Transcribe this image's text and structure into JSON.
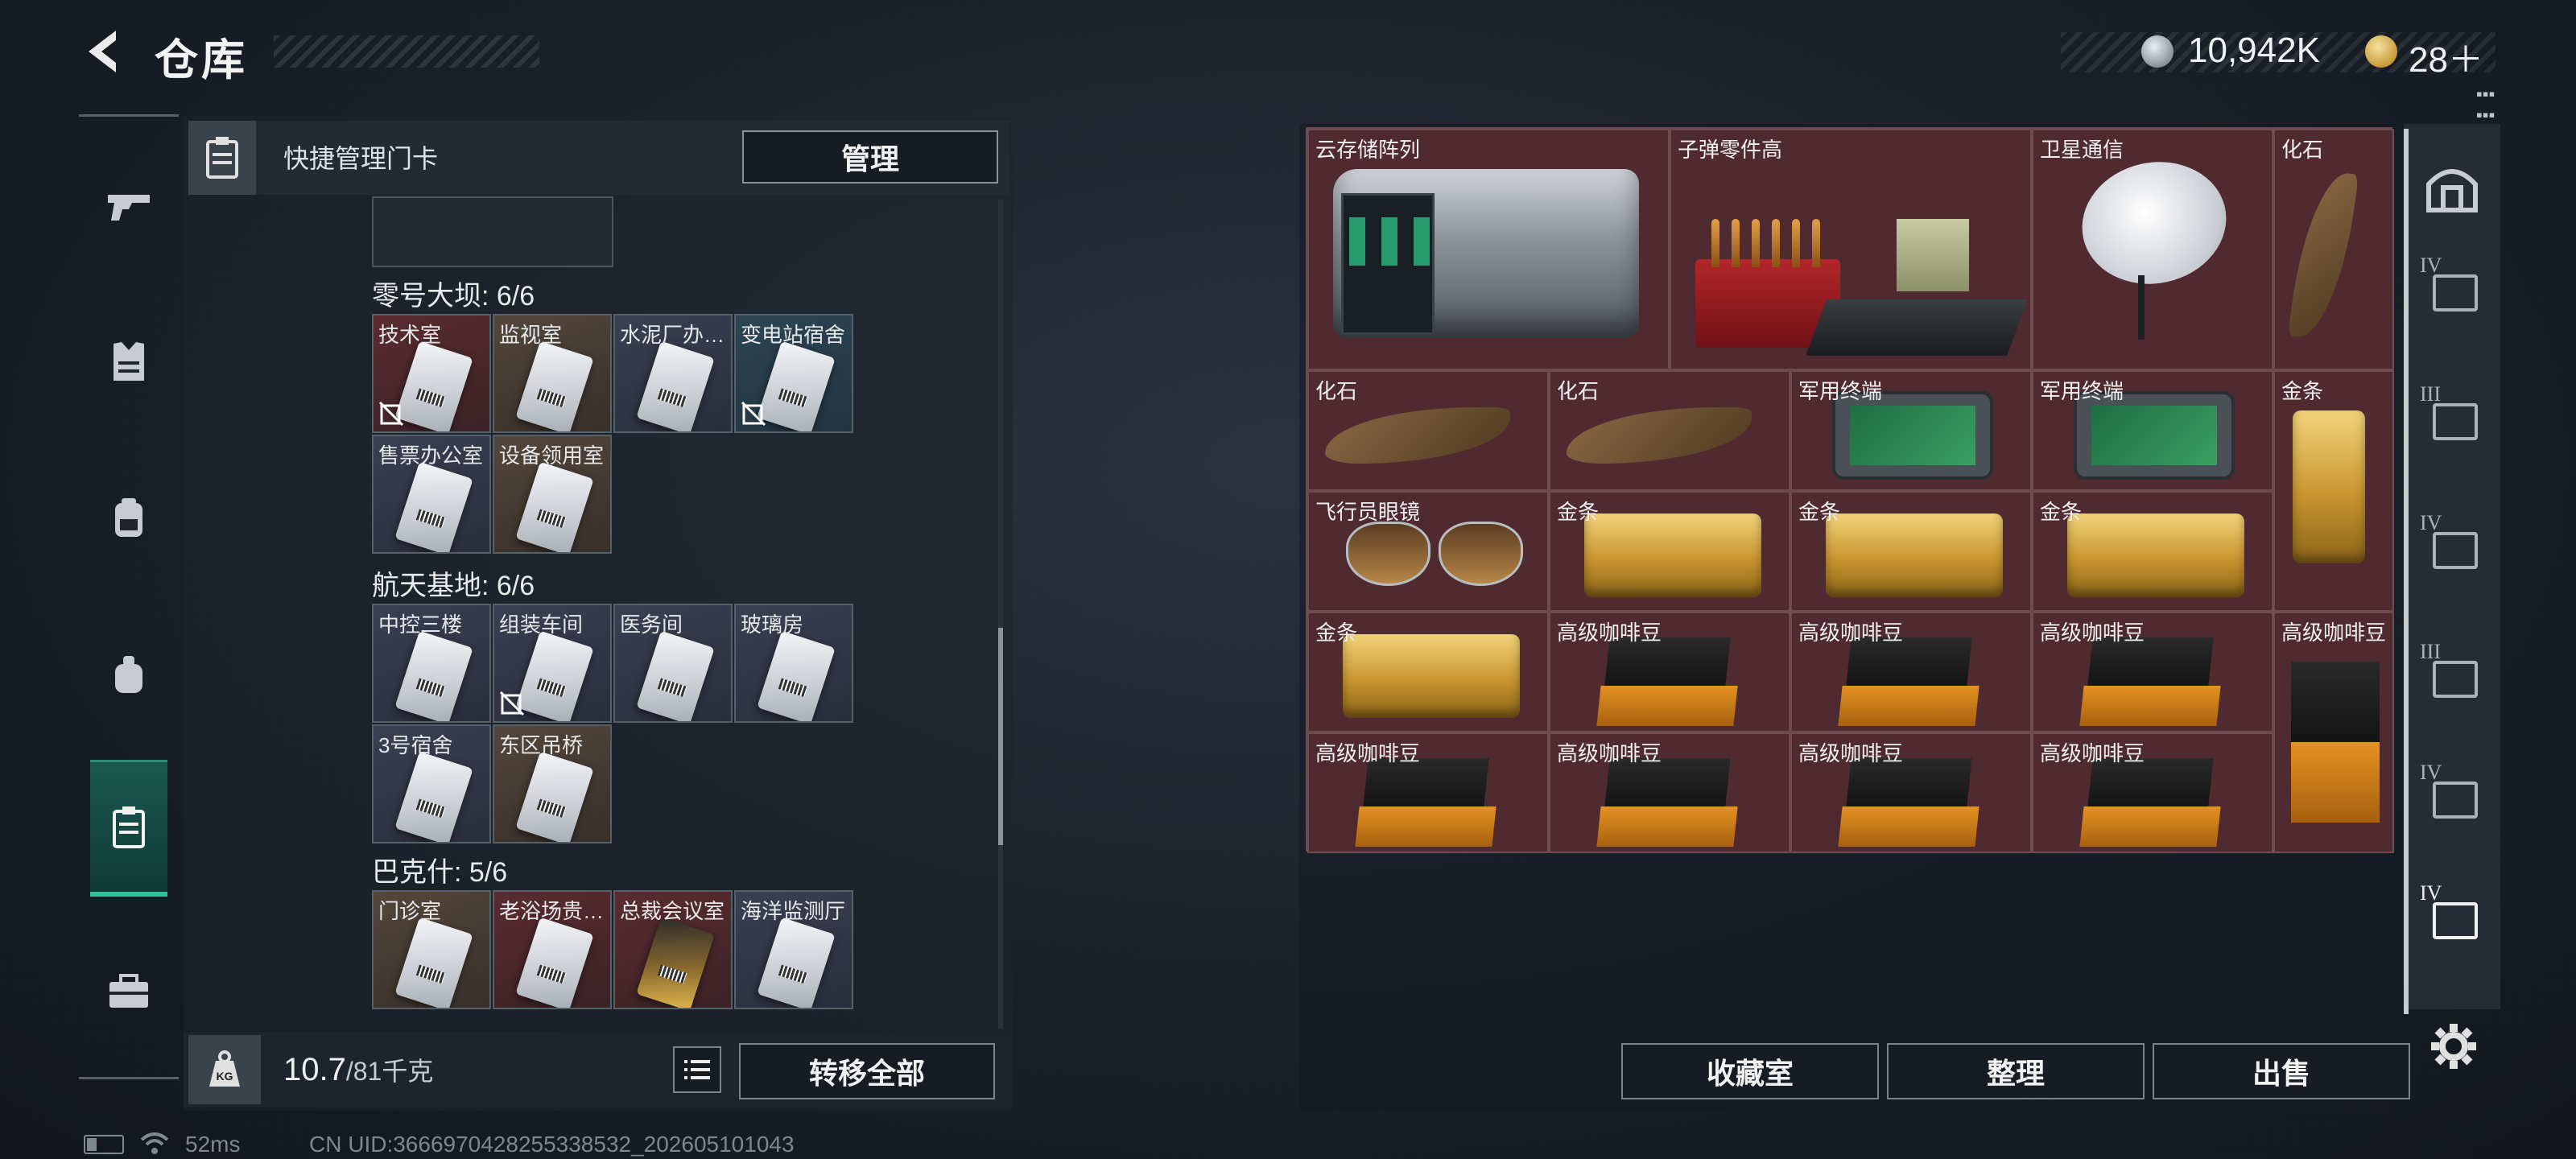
{
  "header": {
    "title": "仓库"
  },
  "currency": {
    "silver": "10,942K",
    "gold": "28＋"
  },
  "left_nav": {
    "items": [
      "gun-icon",
      "vest-icon",
      "backpack-icon",
      "pouch-icon",
      "keycard-icon",
      "toolbox-icon"
    ],
    "active": "keycard-icon"
  },
  "quick_manage": {
    "label": "快捷管理门卡",
    "manage_button": "管理"
  },
  "groups": [
    {
      "title": "零号大坝: 6/6",
      "cards": [
        {
          "label": "技术室",
          "style": "red",
          "unlinked": true
        },
        {
          "label": "监视室",
          "style": "brown",
          "unlinked": false
        },
        {
          "label": "水泥厂办公室",
          "style": "slate",
          "unlinked": false
        },
        {
          "label": "变电站宿舍",
          "style": "teal",
          "unlinked": true
        },
        {
          "label": "售票办公室",
          "style": "slate",
          "unlinked": false
        },
        {
          "label": "设备领用室",
          "style": "brown",
          "unlinked": false
        }
      ]
    },
    {
      "title": "航天基地: 6/6",
      "cards": [
        {
          "label": "中控三楼",
          "style": "slate",
          "unlinked": false
        },
        {
          "label": "组装车间",
          "style": "slate",
          "unlinked": true
        },
        {
          "label": "医务间",
          "style": "slate",
          "unlinked": false
        },
        {
          "label": "玻璃房",
          "style": "slate",
          "unlinked": false
        },
        {
          "label": "3号宿舍",
          "style": "slate",
          "unlinked": false
        },
        {
          "label": "东区吊桥",
          "style": "brown",
          "unlinked": false
        }
      ]
    },
    {
      "title": "巴克什: 5/6",
      "cards": [
        {
          "label": "门诊室",
          "style": "brown",
          "unlinked": false
        },
        {
          "label": "老浴场贵宾室",
          "style": "red",
          "unlinked": false
        },
        {
          "label": "总裁会议室",
          "style": "red",
          "unlinked": false,
          "gold": true
        },
        {
          "label": "海洋监测厅",
          "style": "slate",
          "unlinked": false
        }
      ]
    }
  ],
  "bottom_left": {
    "weight_current": "10.7",
    "weight_max": "/81千克",
    "kg_label": "KG",
    "transfer_button": "转移全部"
  },
  "status": {
    "ping": "52ms",
    "uid": "CN UID:3666970428255338532_202605101043"
  },
  "stash": {
    "items": [
      {
        "label": "云存储阵列",
        "art": "server"
      },
      {
        "label": "子弹零件高",
        "art": "ammo"
      },
      {
        "label": "卫星通信",
        "art": "dish"
      },
      {
        "label": "化石",
        "art": "claw-v"
      },
      {
        "label": "化石",
        "art": "claw-h"
      },
      {
        "label": "化石",
        "art": "claw-h"
      },
      {
        "label": "军用终端",
        "art": "tablet"
      },
      {
        "label": "军用终端",
        "art": "tablet"
      },
      {
        "label": "金条",
        "art": "gold-v"
      },
      {
        "label": "飞行员眼镜",
        "art": "goggles"
      },
      {
        "label": "金条",
        "art": "gold-h"
      },
      {
        "label": "金条",
        "art": "gold-h"
      },
      {
        "label": "金条",
        "art": "gold-h"
      },
      {
        "label": "金条",
        "art": "gold-h"
      },
      {
        "label": "高级咖啡豆",
        "art": "coffee"
      },
      {
        "label": "高级咖啡豆",
        "art": "coffee"
      },
      {
        "label": "高级咖啡豆",
        "art": "coffee"
      },
      {
        "label": "高级咖啡豆",
        "art": "coffee-tall"
      },
      {
        "label": "高级咖啡豆",
        "art": "coffee"
      },
      {
        "label": "高级咖啡豆",
        "art": "coffee"
      },
      {
        "label": "高级咖啡豆",
        "art": "coffee"
      },
      {
        "label": "高级咖啡豆",
        "art": "coffee"
      }
    ]
  },
  "right_tabs": [
    "IV",
    "III",
    "IV",
    "III",
    "IV",
    "IV"
  ],
  "bottom_right": {
    "collection_button": "收藏室",
    "sort_button": "整理",
    "sell_button": "出售"
  }
}
